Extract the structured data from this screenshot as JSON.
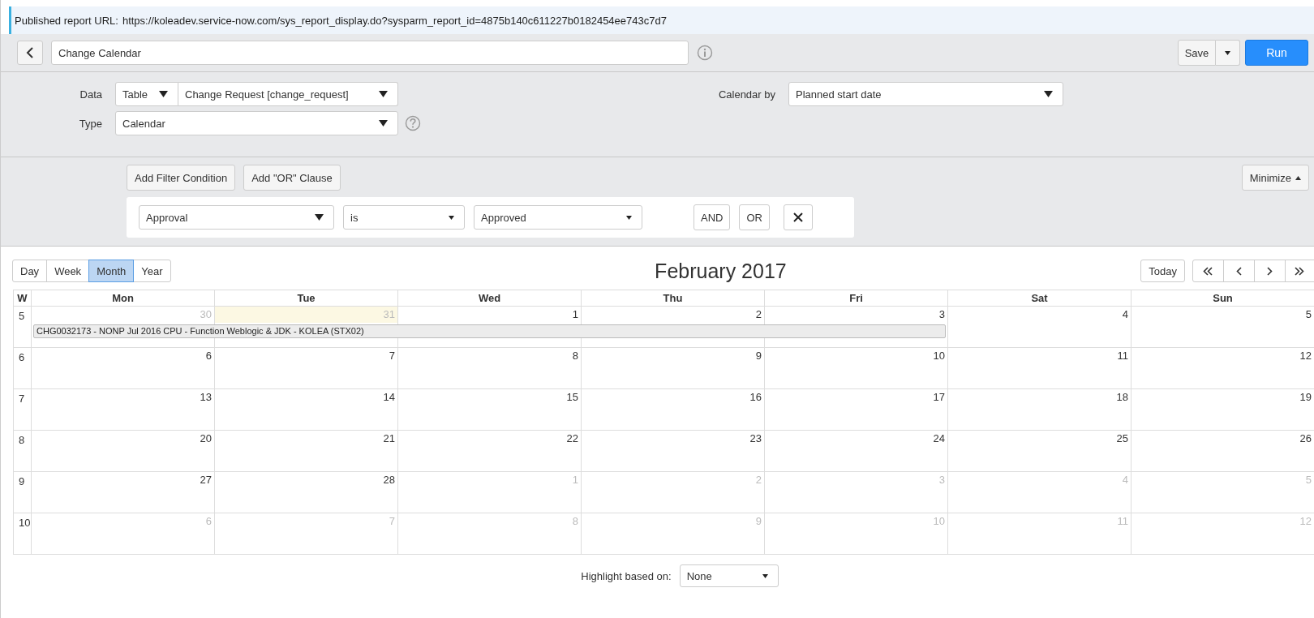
{
  "published_url": {
    "label": "Published report URL:",
    "url": "https://koleadev.service-now.com/sys_report_display.do?sysparm_report_id=4875b140c611227b0182454ee743c7d7"
  },
  "toolbar": {
    "title": "Change Calendar",
    "save": "Save",
    "run": "Run"
  },
  "form": {
    "data_label": "Data",
    "source": "Table",
    "table": "Change Request [change_request]",
    "type_label": "Type",
    "type": "Calendar",
    "calendar_by_label": "Calendar by",
    "calendar_by": "Planned start date"
  },
  "filter": {
    "add_condition": "Add Filter Condition",
    "add_or": "Add \"OR\" Clause",
    "minimize": "Minimize",
    "field": "Approval",
    "operator": "is",
    "value": "Approved",
    "and": "AND",
    "or": "OR"
  },
  "views": [
    {
      "label": "Day",
      "selected": false
    },
    {
      "label": "Week",
      "selected": false
    },
    {
      "label": "Month",
      "selected": true
    },
    {
      "label": "Year",
      "selected": false
    }
  ],
  "title": "February 2017",
  "today": "Today",
  "columns": [
    "W",
    "Mon",
    "Tue",
    "Wed",
    "Thu",
    "Fri",
    "Sat",
    "Sun"
  ],
  "weeks": [
    {
      "week": "5",
      "event": "CHG0032173 - NONP Jul 2016 CPU - Function Weblogic & JDK - KOLEA (STX02)",
      "days": [
        {
          "day": "30",
          "other_month": true,
          "today": false,
          "in_event": true
        },
        {
          "day": "31",
          "other_month": true,
          "today": true,
          "in_event": true
        },
        {
          "day": "1",
          "other_month": false,
          "today": false,
          "in_event": true
        },
        {
          "day": "2",
          "other_month": false,
          "today": false,
          "in_event": true
        },
        {
          "day": "3",
          "other_month": false,
          "today": false,
          "in_event": true
        },
        {
          "day": "4",
          "other_month": false,
          "today": false
        },
        {
          "day": "5",
          "other_month": false,
          "today": false
        }
      ]
    },
    {
      "week": "6",
      "days": [
        {
          "day": "6",
          "other_month": false,
          "today": false
        },
        {
          "day": "7",
          "other_month": false,
          "today": false
        },
        {
          "day": "8",
          "other_month": false,
          "today": false
        },
        {
          "day": "9",
          "other_month": false,
          "today": false
        },
        {
          "day": "10",
          "other_month": false,
          "today": false
        },
        {
          "day": "11",
          "other_month": false,
          "today": false
        },
        {
          "day": "12",
          "other_month": false,
          "today": false
        }
      ]
    },
    {
      "week": "7",
      "days": [
        {
          "day": "13",
          "other_month": false,
          "today": false
        },
        {
          "day": "14",
          "other_month": false,
          "today": false
        },
        {
          "day": "15",
          "other_month": false,
          "today": false
        },
        {
          "day": "16",
          "other_month": false,
          "today": false
        },
        {
          "day": "17",
          "other_month": false,
          "today": false
        },
        {
          "day": "18",
          "other_month": false,
          "today": false
        },
        {
          "day": "19",
          "other_month": false,
          "today": false
        }
      ]
    },
    {
      "week": "8",
      "days": [
        {
          "day": "20",
          "other_month": false,
          "today": false
        },
        {
          "day": "21",
          "other_month": false,
          "today": false
        },
        {
          "day": "22",
          "other_month": false,
          "today": false
        },
        {
          "day": "23",
          "other_month": false,
          "today": false
        },
        {
          "day": "24",
          "other_month": false,
          "today": false
        },
        {
          "day": "25",
          "other_month": false,
          "today": false
        },
        {
          "day": "26",
          "other_month": false,
          "today": false
        }
      ]
    },
    {
      "week": "9",
      "days": [
        {
          "day": "27",
          "other_month": false,
          "today": false
        },
        {
          "day": "28",
          "other_month": false,
          "today": false
        },
        {
          "day": "1",
          "other_month": true,
          "today": false
        },
        {
          "day": "2",
          "other_month": true,
          "today": false
        },
        {
          "day": "3",
          "other_month": true,
          "today": false
        },
        {
          "day": "4",
          "other_month": true,
          "today": false
        },
        {
          "day": "5",
          "other_month": true,
          "today": false
        }
      ]
    },
    {
      "week": "10",
      "days": [
        {
          "day": "6",
          "other_month": true,
          "today": false
        },
        {
          "day": "7",
          "other_month": true,
          "today": false
        },
        {
          "day": "8",
          "other_month": true,
          "today": false
        },
        {
          "day": "9",
          "other_month": true,
          "today": false
        },
        {
          "day": "10",
          "other_month": true,
          "today": false
        },
        {
          "day": "11",
          "other_month": true,
          "today": false
        },
        {
          "day": "12",
          "other_month": true,
          "today": false
        }
      ]
    }
  ],
  "highlight": {
    "label": "Highlight based on:",
    "value": "None"
  }
}
